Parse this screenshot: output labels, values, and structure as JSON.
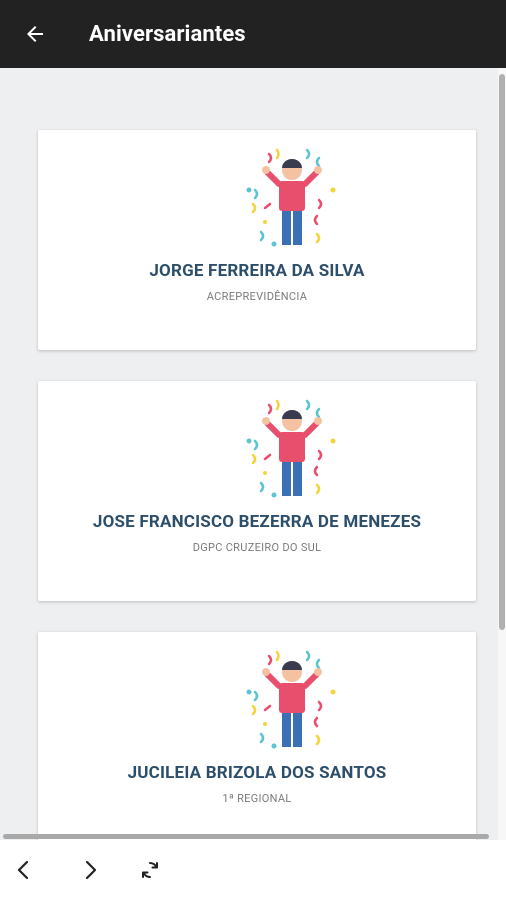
{
  "header": {
    "back_icon": "arrow-left-icon",
    "title": "Aniversariantes"
  },
  "cards": [
    {
      "name": "JORGE FERREIRA DA SILVA",
      "org": "ACREPREVIDÊNCIA",
      "icon": "celebration-person-icon"
    },
    {
      "name": "JOSE FRANCISCO BEZERRA DE MENEZES",
      "org": "DGPC CRUZEIRO DO SUL",
      "icon": "celebration-person-icon"
    },
    {
      "name": "JUCILEIA BRIZOLA DOS SANTOS",
      "org": "1ª REGIONAL",
      "icon": "celebration-person-icon"
    }
  ],
  "bottom_nav": {
    "back_icon": "chevron-left-icon",
    "forward_icon": "chevron-right-icon",
    "refresh_icon": "refresh-icon"
  },
  "colors": {
    "appbar": "#222222",
    "background": "#eeeff1",
    "name_text": "#2c4e6a",
    "org_text": "#7b7b7b",
    "shirt": "#e84f6d",
    "pants": "#3b6fb6"
  }
}
